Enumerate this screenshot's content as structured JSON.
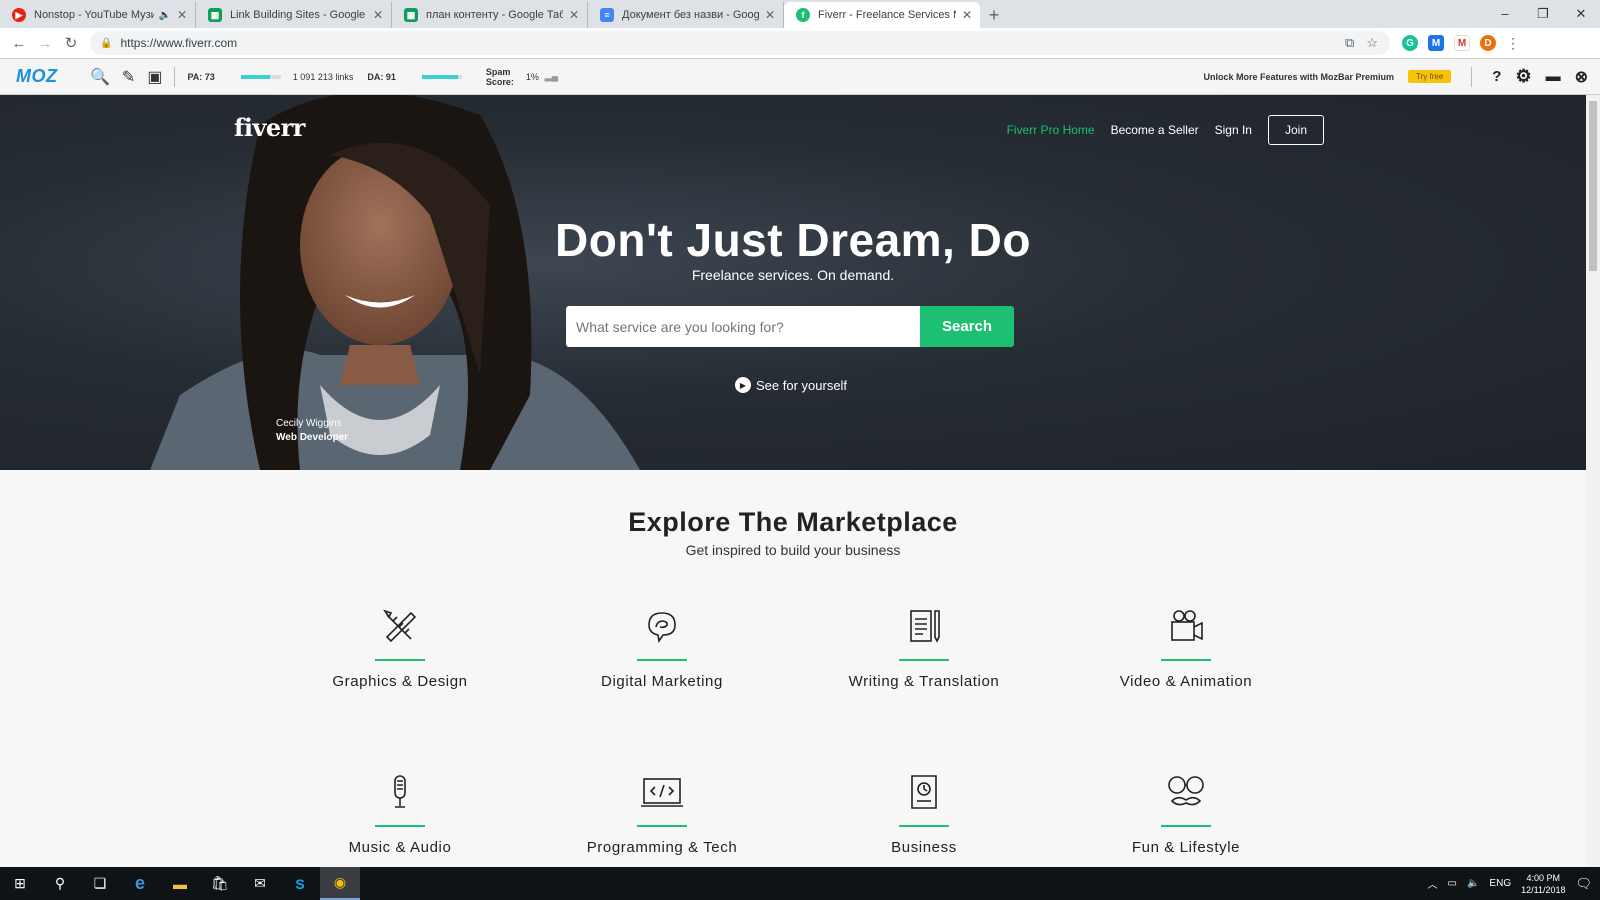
{
  "browser": {
    "tabs": [
      {
        "title": "Nonstop - YouTube Музика",
        "favicon_color": "#e62117",
        "muted": true,
        "active": false
      },
      {
        "title": "Link Building Sites - Google Табл",
        "favicon_color": "#0f9d58",
        "active": false
      },
      {
        "title": "план контенту - Google Таблиці",
        "favicon_color": "#0f9d58",
        "active": false
      },
      {
        "title": "Документ без назви - Google Д",
        "favicon_color": "#4285f4",
        "active": false
      },
      {
        "title": "Fiverr - Freelance Services Marke",
        "favicon_color": "#1dbf73",
        "active": true
      }
    ],
    "url": "https://www.fiverr.com"
  },
  "mozbar": {
    "logo": "MOZ",
    "pa_label": "PA: 73",
    "pa_fill": 0.73,
    "links": "1 091 213 links",
    "da_label": "DA: 91",
    "da_fill": 0.91,
    "spam_label": "Spam Score:",
    "spam_value": "1%",
    "unlock_text": "Unlock More Features with MozBar Premium",
    "try_free": "Try free",
    "help": "?"
  },
  "site": {
    "logo": "fiverr",
    "nav": {
      "pro": "Fiverr Pro Home",
      "seller": "Become a Seller",
      "signin": "Sign In",
      "join": "Join"
    },
    "headline": "Don't Just Dream, Do",
    "subline": "Freelance services. On demand.",
    "search_placeholder": "What service are you looking for?",
    "search_button": "Search",
    "see_link": "See for yourself",
    "caption_name": "Cecily Wiggins",
    "caption_role": "Web Developer",
    "explore_title": "Explore The Marketplace",
    "explore_sub": "Get inspired to build your business",
    "categories": [
      {
        "label": "Graphics & Design",
        "icon": "pencil-ruler-icon"
      },
      {
        "label": "Digital Marketing",
        "icon": "speech-bubble-icon"
      },
      {
        "label": "Writing & Translation",
        "icon": "document-pen-icon"
      },
      {
        "label": "Video & Animation",
        "icon": "video-camera-icon"
      },
      {
        "label": "Music & Audio",
        "icon": "microphone-icon"
      },
      {
        "label": "Programming & Tech",
        "icon": "laptop-code-icon"
      },
      {
        "label": "Business",
        "icon": "business-document-icon"
      },
      {
        "label": "Fun & Lifestyle",
        "icon": "glasses-mustache-icon"
      }
    ]
  },
  "taskbar": {
    "lang": "ENG",
    "time": "4:00 PM",
    "date": "12/11/2018"
  },
  "colors": {
    "brand_green": "#1dbf73",
    "hero_dark": "#262c33",
    "moz_blue": "#1d8fdb"
  }
}
